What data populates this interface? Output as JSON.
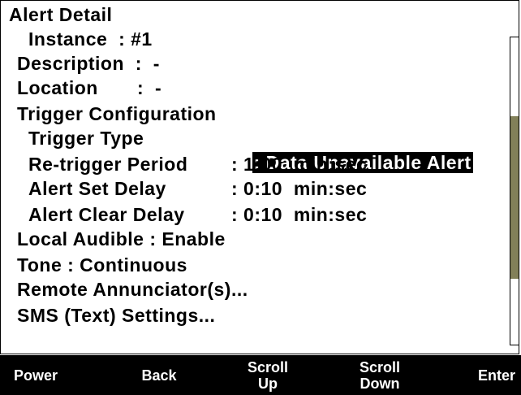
{
  "screen": {
    "title": "Alert Detail",
    "instance": "Instance  : #1",
    "description": "Description  :  -",
    "location": "Location       :  -",
    "trigger_configuration": "Trigger Configuration",
    "trigger_type_label": "Trigger Type",
    "trigger_type_value": ": Data Unavailable Alert",
    "retrigger_label": "Re-trigger Period",
    "retrigger_value": ": 1:00  min:sec",
    "set_delay_label": "Alert Set Delay",
    "set_delay_value": ": 0:10  min:sec",
    "clear_delay_label": "Alert Clear Delay",
    "clear_delay_value": ": 0:10  min:sec",
    "local_audible": "Local Audible : Enable",
    "tone": "Tone : Continuous",
    "remote_annunciators": "Remote Annunciator(s)...",
    "sms_settings": "SMS (Text) Settings..."
  },
  "softkeys": {
    "power": "Power",
    "back": "Back",
    "scroll_up": "Scroll\nUp",
    "scroll_down": "Scroll\nDown",
    "enter": "Enter"
  },
  "scrollbar": {
    "thumb_color": "#828059"
  }
}
